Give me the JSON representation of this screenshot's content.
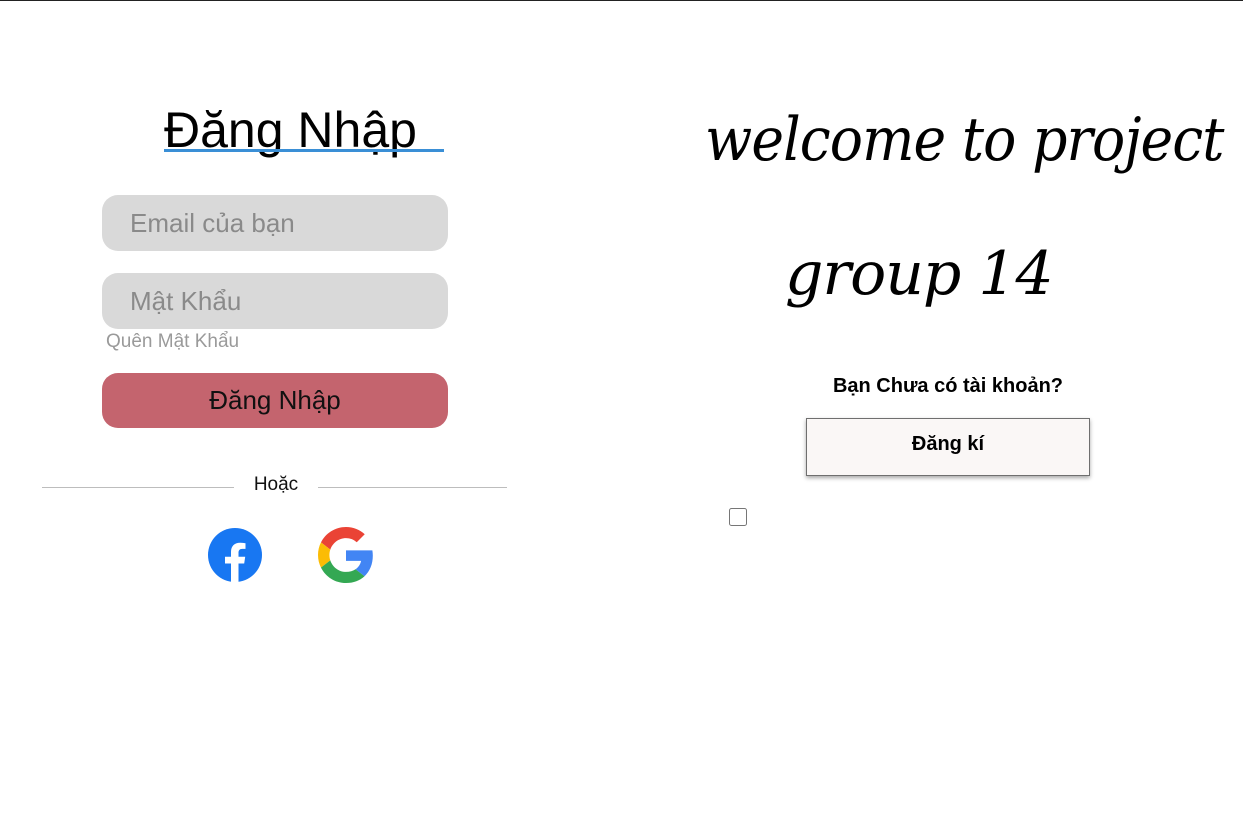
{
  "login": {
    "title": "Đăng Nhập",
    "email_placeholder": "Email của bạn",
    "password_placeholder": "Mật Khẩu",
    "forgot_password": "Quên Mật Khẩu",
    "submit_label": "Đăng Nhập",
    "divider_text": "Hoặc",
    "social": [
      {
        "name": "facebook-icon",
        "color": "#1877F2"
      },
      {
        "name": "google-icon",
        "colors": [
          "#EA4335",
          "#FBBC05",
          "#34A853",
          "#4285F4"
        ]
      }
    ]
  },
  "welcome": {
    "line1": "welcome to project",
    "line2": "group 14"
  },
  "register": {
    "prompt": "Bạn Chưa có tài khoản?",
    "button_label": "Đăng kí"
  },
  "colors": {
    "input_bg": "#d9d9d9",
    "login_button": "#c4646e",
    "title_underline": "#3a8fd6",
    "register_button_bg": "#faf7f6"
  }
}
